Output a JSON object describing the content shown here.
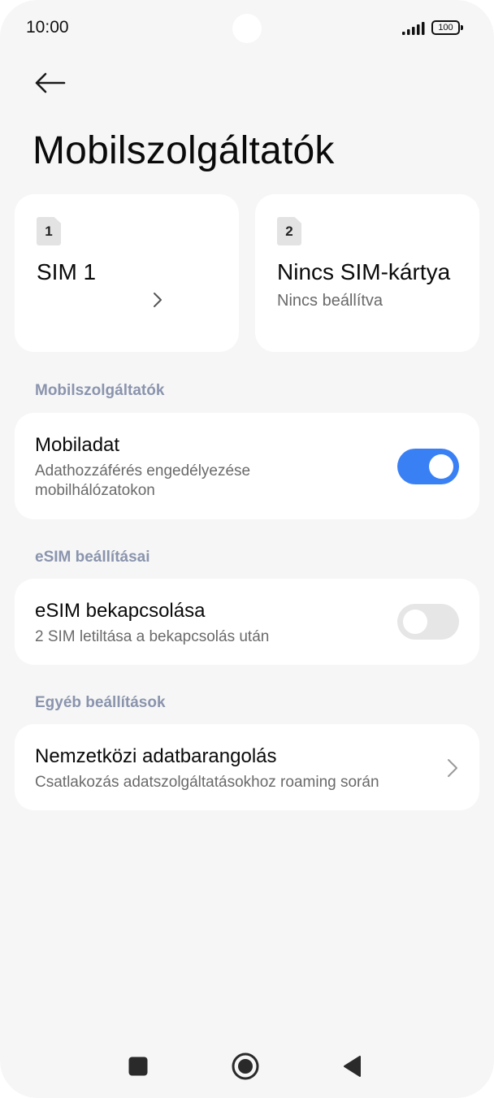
{
  "status_bar": {
    "time": "10:00",
    "battery": "100",
    "icons": [
      "signal-icon",
      "battery-icon"
    ]
  },
  "header": {
    "back_icon": "arrow-left-icon",
    "title": "Mobilszolgáltatók"
  },
  "sim_cards": [
    {
      "slot": "1",
      "name": "SIM 1",
      "subtitle": "",
      "icon": "chevron-right-icon"
    },
    {
      "slot": "2",
      "name": "Nincs SIM-kártya",
      "subtitle": "Nincs beállítva"
    }
  ],
  "sections": {
    "mobile": {
      "header": "Mobilszolgáltatók",
      "mobile_data": {
        "title": "Mobiladat",
        "subtitle_line1": "Adathozzáférés engedélyezése",
        "subtitle_line2": "mobilhálózatokon",
        "enabled": true
      }
    },
    "esim": {
      "header": "eSIM beállításai",
      "esim_toggle": {
        "title": "eSIM bekapcsolása",
        "subtitle": "2 SIM letiltása a bekapcsolás után",
        "enabled": false
      }
    },
    "other": {
      "header": "Egyéb beállítások",
      "roaming": {
        "title": "Nemzetközi adatbarangolás",
        "subtitle": "Csatlakozás adatszolgáltatásokhoz roaming során",
        "icon": "chevron-right-icon"
      }
    }
  },
  "nav_bar": {
    "items": [
      "recents-square-icon",
      "home-circle-icon",
      "back-triangle-icon"
    ]
  },
  "colors": {
    "accent": "#3a80f5",
    "background": "#f6f6f6",
    "section_header": "#8a94ad"
  }
}
